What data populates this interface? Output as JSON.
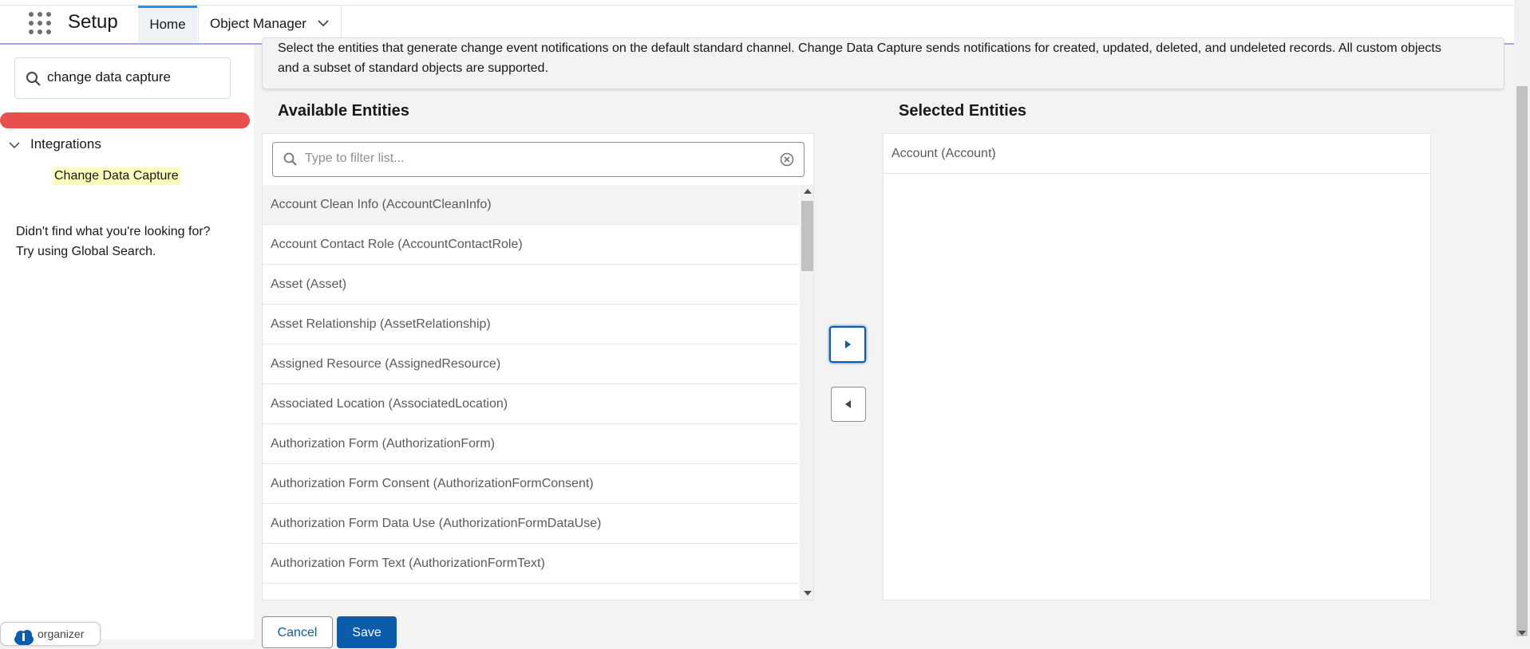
{
  "header": {
    "app_title": "Setup",
    "tabs": [
      {
        "label": "Home",
        "active": true
      },
      {
        "label": "Object Manager",
        "has_dropdown": true
      }
    ]
  },
  "sidebar": {
    "search_value": "change data capture",
    "tree": {
      "group_label": "Integrations",
      "expanded": true,
      "items": [
        {
          "label": "Change Data Capture",
          "highlighted": true
        }
      ]
    },
    "not_found_line1": "Didn't find what you're looking for?",
    "not_found_line2": "Try using Global Search."
  },
  "main": {
    "description_line1": "Select the entities that generate change event notifications on the default standard channel. Change Data Capture sends notifications for created, updated, deleted, and undeleted records. All custom objects",
    "description_line2": "and a subset of standard objects are supported.",
    "available_title": "Available Entities",
    "selected_title": "Selected Entities",
    "filter_placeholder": "Type to filter list...",
    "available_items": [
      "Account Clean Info (AccountCleanInfo)",
      "Account Contact Role (AccountContactRole)",
      "Asset (Asset)",
      "Asset Relationship (AssetRelationship)",
      "Assigned Resource (AssignedResource)",
      "Associated Location (AssociatedLocation)",
      "Authorization Form (AuthorizationForm)",
      "Authorization Form Consent (AuthorizationFormConsent)",
      "Authorization Form Data Use (AuthorizationFormDataUse)",
      "Authorization Form Text (AuthorizationFormText)"
    ],
    "selected_items": [
      "Account (Account)"
    ],
    "buttons": {
      "cancel": "Cancel",
      "save": "Save"
    }
  },
  "extension": {
    "label": "organizer"
  },
  "colors": {
    "brand_blue": "#0b5cab",
    "highlight": "#fafdb9",
    "red_bar": "#e8504e",
    "active_tab_accent": "#1b96ff"
  },
  "icons": {
    "waffle": "app-launcher-icon",
    "search": "search-icon",
    "clear": "clear-icon",
    "chevron": "chevron-down-icon",
    "move_right": "move-right-icon",
    "move_left": "move-left-icon"
  }
}
